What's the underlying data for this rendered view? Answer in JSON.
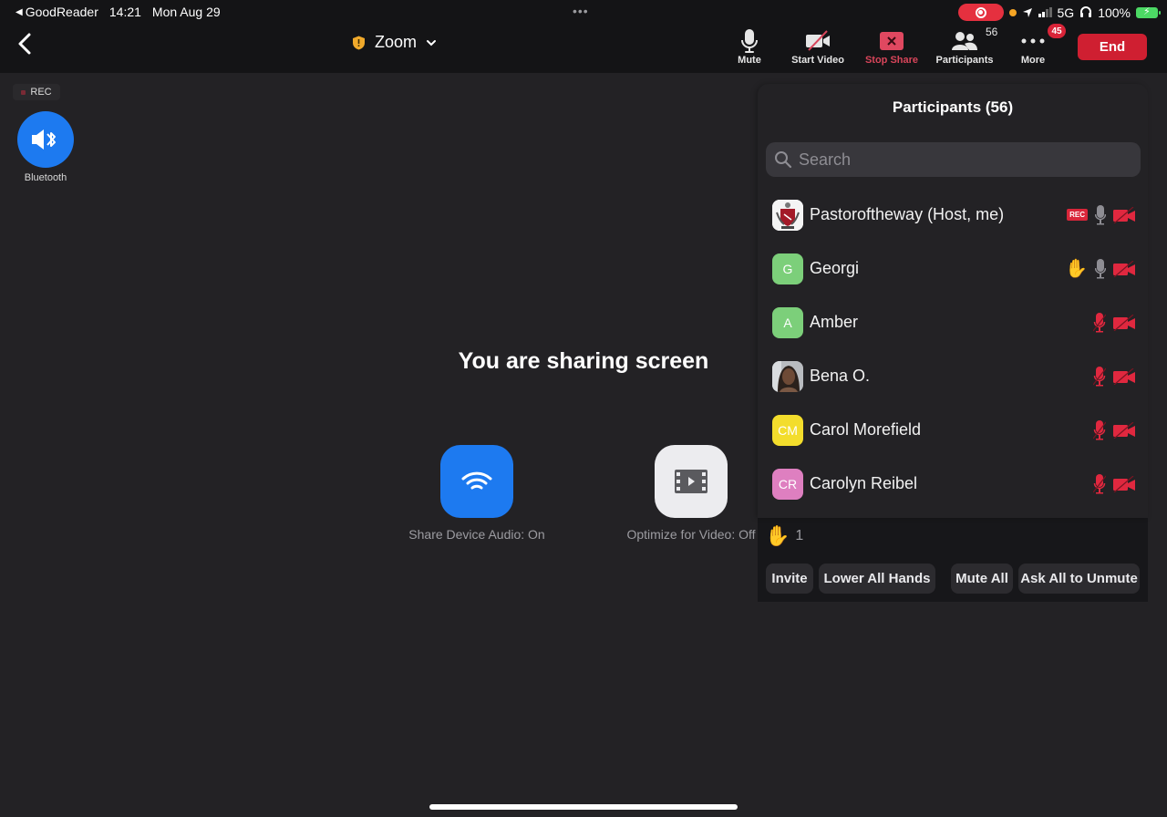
{
  "status_bar": {
    "back_app": "GoodReader",
    "time": "14:21",
    "date": "Mon Aug 29",
    "network": "5G",
    "battery": "100%",
    "recording_indicator_color": "#e5303f"
  },
  "toolbar": {
    "meeting_title": "Zoom",
    "buttons": {
      "mute": "Mute",
      "start_video": "Start Video",
      "stop_share": "Stop Share",
      "participants": "Participants",
      "participants_count": "56",
      "more": "More",
      "more_badge": "45"
    },
    "end_label": "End",
    "end_color": "#cf1f31",
    "share_color": "#d8455a"
  },
  "left": {
    "rec_label": "REC",
    "audio_button_label": "Bluetooth"
  },
  "sharing": {
    "title": "You are sharing screen",
    "options": [
      {
        "label": "Share Device Audio: On",
        "icon": "wifi-audio-icon"
      },
      {
        "label": "Optimize for Video: Off",
        "icon": "film-play-icon"
      }
    ],
    "accent": "#1d7af0"
  },
  "participants_panel": {
    "title": "Participants (56)",
    "search_placeholder": "Search",
    "participants": [
      {
        "name": "Pastoroftheway (Host, me)",
        "initials": "",
        "avatar": "crest-image",
        "rec": "REC",
        "raised_hand": false,
        "mic": "on",
        "video": "off"
      },
      {
        "name": "Georgi",
        "initials": "G",
        "avatar_color": "#7ccf7a",
        "raised_hand": true,
        "mic": "on",
        "video": "off"
      },
      {
        "name": "Amber",
        "initials": "A",
        "avatar_color": "#7ccf7a",
        "raised_hand": false,
        "mic": "muted",
        "video": "off"
      },
      {
        "name": "Bena O.",
        "initials": "",
        "avatar": "photo",
        "raised_hand": false,
        "mic": "muted",
        "video": "off"
      },
      {
        "name": "Carol Morefield",
        "initials": "CM",
        "avatar_color": "#f3dd2c",
        "raised_hand": false,
        "mic": "muted",
        "video": "off"
      },
      {
        "name": "Carolyn Reibel",
        "initials": "CR",
        "avatar_color": "#de7fc0",
        "raised_hand": false,
        "mic": "muted",
        "video": "off"
      }
    ],
    "raised_hands_count": "1",
    "buttons": {
      "invite": "Invite",
      "lower_all_hands": "Lower All Hands",
      "mute_all": "Mute All",
      "ask_all_to_unmute": "Ask All to Unmute"
    }
  }
}
